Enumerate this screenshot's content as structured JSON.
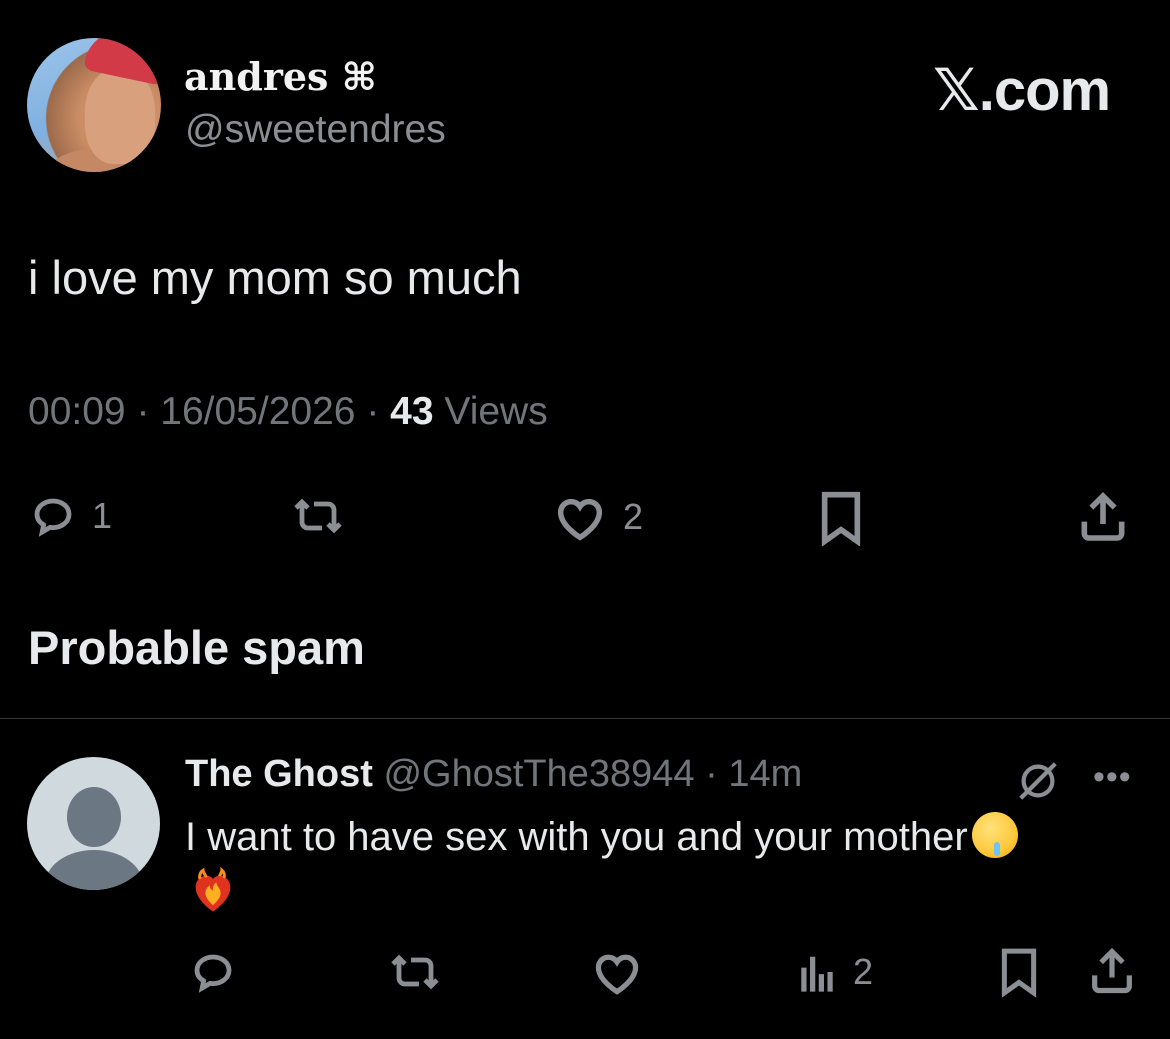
{
  "author": {
    "display_name": "andres ⌘",
    "handle": "@sweetendres"
  },
  "brand": "𝕏.com",
  "tweet": {
    "text": "i love my mom so much",
    "time": "00:09",
    "sep1": " · ",
    "date": "16/05/2026",
    "sep2": " · ",
    "views_count": "43",
    "views_label": " Views"
  },
  "actions": {
    "reply_count": "1",
    "like_count": "2"
  },
  "section_heading": "Probable spam",
  "reply": {
    "name": "The Ghost",
    "handle": " @GhostThe38944",
    "sep": " · ",
    "time": "14m",
    "text": "I want to have sex with you and your mother",
    "views_count": "2"
  },
  "colors": {
    "background": "#000000",
    "primary_text": "#e7e9ea",
    "secondary_text": "#71767b",
    "divider": "#2f3336"
  },
  "icons": [
    "comment-icon",
    "retweet-icon",
    "heart-icon",
    "bookmark-icon",
    "share-icon",
    "analytics-icon",
    "grok-icon",
    "more-icon"
  ]
}
